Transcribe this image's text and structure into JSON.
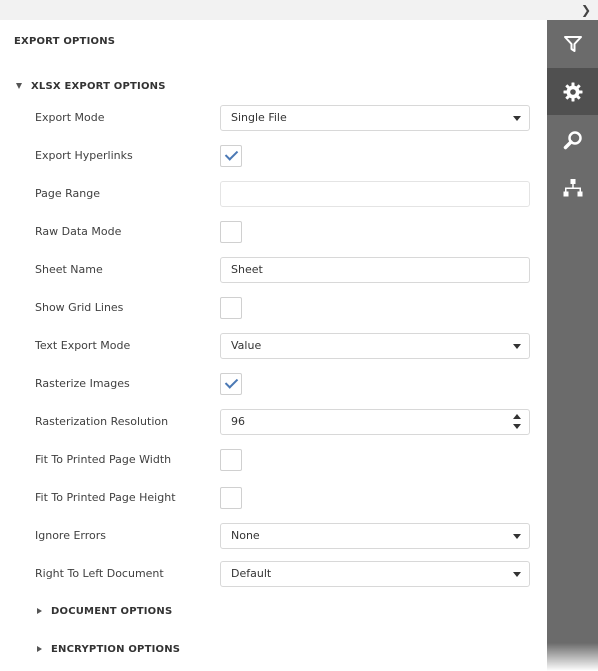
{
  "header": {
    "collapse_icon": "chevron-right-icon"
  },
  "panel": {
    "title": "EXPORT OPTIONS",
    "group": {
      "label": "XLSX EXPORT OPTIONS",
      "fields": {
        "export_mode": {
          "label": "Export Mode",
          "value": "Single File"
        },
        "export_hyperlinks": {
          "label": "Export Hyperlinks",
          "checked": true
        },
        "page_range": {
          "label": "Page Range",
          "value": ""
        },
        "raw_data_mode": {
          "label": "Raw Data Mode",
          "checked": false
        },
        "sheet_name": {
          "label": "Sheet Name",
          "value": "Sheet"
        },
        "show_grid_lines": {
          "label": "Show Grid Lines",
          "checked": false
        },
        "text_export_mode": {
          "label": "Text Export Mode",
          "value": "Value"
        },
        "rasterize_images": {
          "label": "Rasterize Images",
          "checked": true
        },
        "rasterization_resolution": {
          "label": "Rasterization Resolution",
          "value": "96"
        },
        "fit_page_width": {
          "label": "Fit To Printed Page Width",
          "checked": false
        },
        "fit_page_height": {
          "label": "Fit To Printed Page Height",
          "checked": false
        },
        "ignore_errors": {
          "label": "Ignore Errors",
          "value": "None"
        },
        "right_to_left": {
          "label": "Right To Left Document",
          "value": "Default"
        }
      },
      "subgroups": {
        "document_options": "DOCUMENT OPTIONS",
        "encryption_options": "ENCRYPTION OPTIONS"
      }
    }
  },
  "sidebar": {
    "buttons": [
      {
        "icon": "filter-icon",
        "active": false
      },
      {
        "icon": "gear-icon",
        "active": true
      },
      {
        "icon": "search-icon",
        "active": false
      },
      {
        "icon": "document-map-icon",
        "active": false
      }
    ]
  },
  "colors": {
    "sidebar_bg": "#6b6b6b",
    "sidebar_active": "#505050",
    "check": "#4b79b5",
    "icon": "#ffffff"
  }
}
